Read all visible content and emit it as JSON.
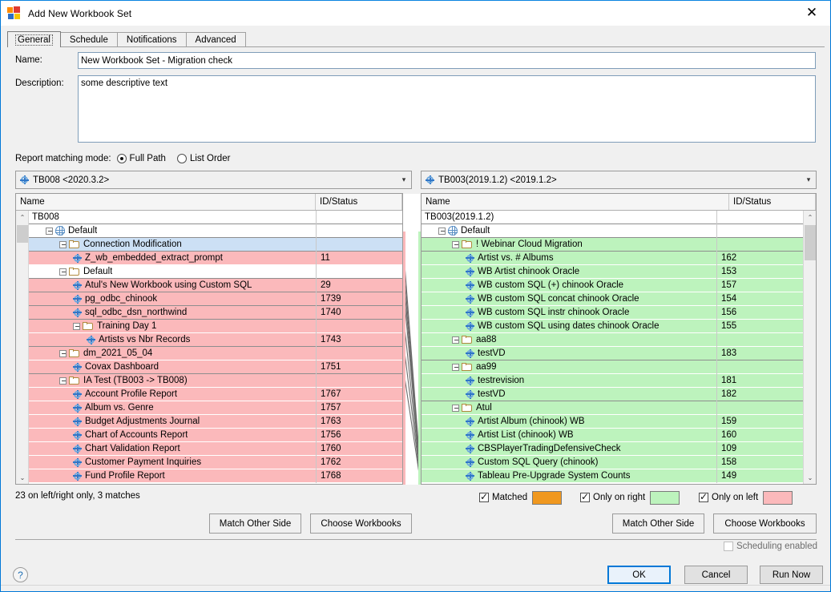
{
  "window": {
    "title": "Add New Workbook Set",
    "app_icon": "tableau-squares-icon",
    "close_label": "✕"
  },
  "tabs": [
    {
      "label": "General",
      "active": true
    },
    {
      "label": "Schedule",
      "active": false
    },
    {
      "label": "Notifications",
      "active": false
    },
    {
      "label": "Advanced",
      "active": false
    }
  ],
  "form": {
    "name_label": "Name:",
    "name_value": "New Workbook Set - Migration check",
    "description_label": "Description:",
    "description_value": "some descriptive text"
  },
  "matching_mode": {
    "label": "Report matching mode:",
    "options": [
      {
        "label": "Full Path",
        "selected": true
      },
      {
        "label": "List Order",
        "selected": false
      }
    ]
  },
  "combos": {
    "left": {
      "text": "TB008 <2020.3.2>",
      "arrow": "▾"
    },
    "right": {
      "text": "TB003(2019.1.2) <2019.1.2>",
      "arrow": "▾"
    }
  },
  "columns": {
    "name": "Name",
    "id_status": "ID/Status"
  },
  "left_tree": {
    "rows": [
      {
        "indent": 0,
        "kind": "root",
        "state": "plain",
        "label": "TB008",
        "id": ""
      },
      {
        "indent": 1,
        "kind": "globe",
        "state": "plain",
        "label": "Default",
        "id": ""
      },
      {
        "indent": 2,
        "kind": "folder",
        "state": "sel",
        "label": "Connection Modification",
        "id": ""
      },
      {
        "indent": 3,
        "kind": "flake",
        "state": "pink",
        "label": "Z_wb_embedded_extract_prompt",
        "id": "11"
      },
      {
        "indent": 2,
        "kind": "folder",
        "state": "plain",
        "label": "Default",
        "id": ""
      },
      {
        "indent": 3,
        "kind": "flake",
        "state": "pinkhdr",
        "label": "Atul's New Workbook using Custom SQL",
        "id": "29"
      },
      {
        "indent": 3,
        "kind": "flake",
        "state": "pinkhdr",
        "label": "pg_odbc_chinook",
        "id": "1739"
      },
      {
        "indent": 3,
        "kind": "flake",
        "state": "pinkhdr",
        "label": "sql_odbc_dsn_northwind",
        "id": "1740"
      },
      {
        "indent": 3,
        "kind": "folder",
        "state": "pink",
        "label": "Training Day 1",
        "id": ""
      },
      {
        "indent": 4,
        "kind": "flake",
        "state": "pinkhdr",
        "label": "Artists vs Nbr Records",
        "id": "1743"
      },
      {
        "indent": 2,
        "kind": "folder",
        "state": "pink",
        "label": "dm_2021_05_04",
        "id": ""
      },
      {
        "indent": 3,
        "kind": "flake",
        "state": "pinkhdr",
        "label": "Covax Dashboard",
        "id": "1751"
      },
      {
        "indent": 2,
        "kind": "folder",
        "state": "pink",
        "label": "IA Test (TB003 -> TB008)",
        "id": ""
      },
      {
        "indent": 3,
        "kind": "flake",
        "state": "pink",
        "label": "Account Profile Report",
        "id": "1767"
      },
      {
        "indent": 3,
        "kind": "flake",
        "state": "pink",
        "label": "Album vs. Genre",
        "id": "1757"
      },
      {
        "indent": 3,
        "kind": "flake",
        "state": "pink",
        "label": "Budget Adjustments Journal",
        "id": "1763"
      },
      {
        "indent": 3,
        "kind": "flake",
        "state": "pink",
        "label": "Chart of Accounts Report",
        "id": "1756"
      },
      {
        "indent": 3,
        "kind": "flake",
        "state": "pink",
        "label": "Chart Validation Report",
        "id": "1760"
      },
      {
        "indent": 3,
        "kind": "flake",
        "state": "pink",
        "label": "Customer Payment Inquiries",
        "id": "1762"
      },
      {
        "indent": 3,
        "kind": "flake",
        "state": "pink",
        "label": "Fund Profile Report",
        "id": "1768"
      }
    ]
  },
  "right_tree": {
    "rows": [
      {
        "indent": 0,
        "kind": "root",
        "state": "plain",
        "label": "TB003(2019.1.2)",
        "id": ""
      },
      {
        "indent": 1,
        "kind": "globe",
        "state": "plain",
        "label": "Default",
        "id": ""
      },
      {
        "indent": 2,
        "kind": "folder",
        "state": "greenhdr",
        "label": "! Webinar Cloud Migration",
        "id": ""
      },
      {
        "indent": 3,
        "kind": "flake",
        "state": "green",
        "label": "Artist vs. # Albums",
        "id": "162"
      },
      {
        "indent": 3,
        "kind": "flake",
        "state": "green",
        "label": "WB Artist chinook Oracle",
        "id": "153"
      },
      {
        "indent": 3,
        "kind": "flake",
        "state": "green",
        "label": "WB custom SQL (+) chinook Oracle",
        "id": "157"
      },
      {
        "indent": 3,
        "kind": "flake",
        "state": "green",
        "label": "WB custom SQL concat chinook Oracle",
        "id": "154"
      },
      {
        "indent": 3,
        "kind": "flake",
        "state": "green",
        "label": "WB custom SQL instr chinook Oracle",
        "id": "156"
      },
      {
        "indent": 3,
        "kind": "flake",
        "state": "green",
        "label": "WB custom SQL using dates chinook Oracle",
        "id": "155"
      },
      {
        "indent": 2,
        "kind": "folder",
        "state": "green",
        "label": "aa88",
        "id": ""
      },
      {
        "indent": 3,
        "kind": "flake",
        "state": "greenhdr",
        "label": "testVD",
        "id": "183"
      },
      {
        "indent": 2,
        "kind": "folder",
        "state": "green",
        "label": "aa99",
        "id": ""
      },
      {
        "indent": 3,
        "kind": "flake",
        "state": "green",
        "label": "testrevision",
        "id": "181"
      },
      {
        "indent": 3,
        "kind": "flake",
        "state": "greenhdr",
        "label": "testVD",
        "id": "182"
      },
      {
        "indent": 2,
        "kind": "folder",
        "state": "green",
        "label": "Atul",
        "id": ""
      },
      {
        "indent": 3,
        "kind": "flake",
        "state": "green",
        "label": "Artist Album (chinook) WB",
        "id": "159"
      },
      {
        "indent": 3,
        "kind": "flake",
        "state": "green",
        "label": "Artist List (chinook) WB",
        "id": "160"
      },
      {
        "indent": 3,
        "kind": "flake",
        "state": "green",
        "label": "CBSPlayerTradingDefensiveCheck",
        "id": "109"
      },
      {
        "indent": 3,
        "kind": "flake",
        "state": "green",
        "label": "Custom SQL  Query (chinook)",
        "id": "158"
      },
      {
        "indent": 3,
        "kind": "flake",
        "state": "green",
        "label": "Tableau Pre-Upgrade System Counts",
        "id": "149"
      }
    ]
  },
  "status": {
    "text": "23 on left/right only, 3 matches"
  },
  "legend": [
    {
      "label": "Matched",
      "checked": true,
      "color": "#f0981f"
    },
    {
      "label": "Only on right",
      "checked": true,
      "color": "#bdf3bd"
    },
    {
      "label": "Only on left",
      "checked": true,
      "color": "#fbb9bb"
    }
  ],
  "buttons": {
    "match_other_side_left": "Match Other Side",
    "choose_workbooks_left": "Choose Workbooks",
    "match_other_side_right": "Match Other Side",
    "choose_workbooks_right": "Choose Workbooks",
    "ok": "OK",
    "cancel": "Cancel",
    "run_now": "Run Now",
    "help": "?"
  },
  "scheduling": {
    "label": "Scheduling enabled",
    "checked": false,
    "disabled": true
  }
}
